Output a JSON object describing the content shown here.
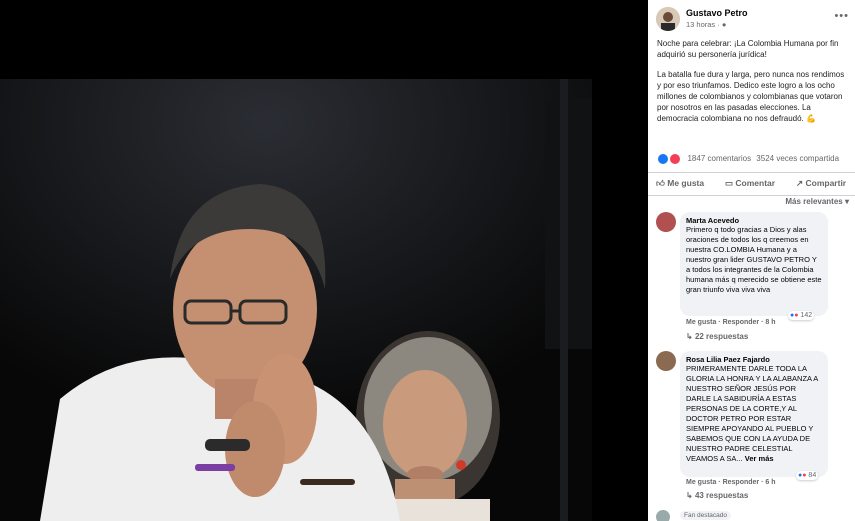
{
  "post": {
    "author": "Gustavo Petro",
    "time": "13 horas",
    "paragraph1": "Noche para celebrar: ¡La Colombia Humana por fin adquirió su personería jurídica!",
    "paragraph2": "La batalla fue dura y larga, pero nunca nos rendimos y por eso triunfamos. Dedico este logro a los ocho millones de colombianos y colombianas que votaron por nosotros en las pasadas elecciones. La democracia colombiana no nos defraudó. 💪",
    "comments_count": "1847 comentarios",
    "shares_count": "3524 veces compartida",
    "reaction_icons": [
      "like-icon",
      "love-icon"
    ]
  },
  "actions": {
    "like": "Me gusta",
    "comment": "Comentar",
    "share": "Compartir"
  },
  "sort_label": "Más relevantes",
  "comments": [
    {
      "name": "Marta Acevedo",
      "text": "Primero q todo gracias a Dios y alas oraciones de todos los q creemos en nuestra CO.LOMBIA Humana y a nuestro gran lider GUSTAVO PETRO Y a todos los integrantes de la Colombia humana más q merecido se obtiene este gran triunfo viva viva viva",
      "like": "Me gusta",
      "reply": "Responder",
      "time": "8 h",
      "reactions": "142",
      "replies": "22 respuestas"
    },
    {
      "name": "Rosa Lilia Paez Fajardo",
      "text": "PRIMERAMENTE DARLE TODA LA GLORIA LA HONRA Y LA ALABANZA A NUESTRO SEÑOR JESÚS POR DARLE LA SABIDURÍA A ESTAS PERSONAS DE LA CORTE,Y AL DOCTOR PETRO POR ESTAR SIEMPRE APOYANDO AL PUEBLO Y SABEMOS QUE CON LA AYUDA DE NUESTRO PADRE CELESTIAL VEAMOS A SA...",
      "see_more": "Ver más",
      "like": "Me gusta",
      "reply": "Responder",
      "time": "6 h",
      "reactions": "84",
      "replies": "43 respuestas"
    }
  ],
  "fan_badge": "Fan destacado",
  "colors": {
    "like_blue": "#1877f2",
    "love_red": "#f33e58",
    "meta_gray": "#65676b",
    "bubble_gray": "#f0f2f5"
  }
}
